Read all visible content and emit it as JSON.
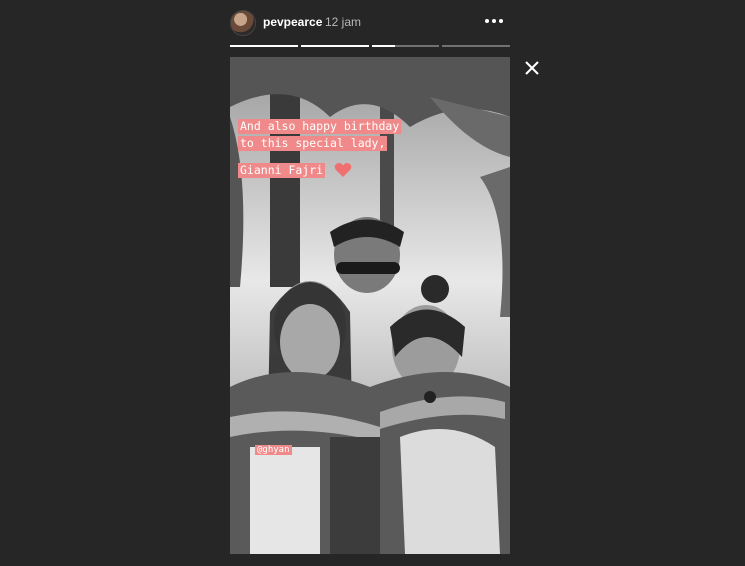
{
  "header": {
    "username": "pevpearce",
    "timestamp": "12 jam"
  },
  "icons": {
    "more": "more-horizontal-icon",
    "close": "close-icon",
    "heart": "heart-icon"
  },
  "progress": [
    1,
    1,
    0.35,
    0
  ],
  "story": {
    "caption_lines": [
      "And also happy birthday",
      "to this special lady,"
    ],
    "caption_name": "Gianni Fajri",
    "mention": "@ghyan"
  },
  "colors": {
    "background": "#262626",
    "caption_bg": "#f08a8a",
    "heart": "#f07070"
  }
}
